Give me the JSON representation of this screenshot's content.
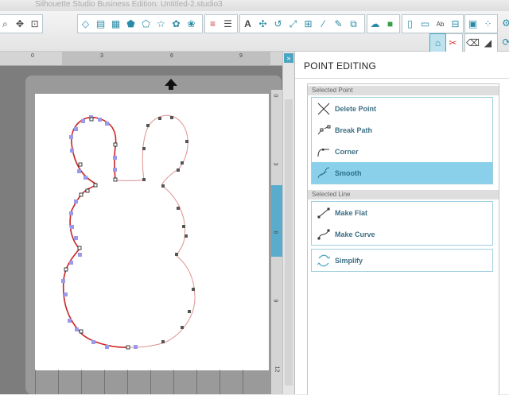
{
  "window": {
    "title": "Silhouette Studio Business Edition: Untitled-2.studio3"
  },
  "toolbar": {
    "text_tool_label": "A",
    "text_style_label": "Ab"
  },
  "ruler": {
    "top_numbers": [
      "0",
      "3",
      "6",
      "9"
    ],
    "right_numbers": [
      "0",
      "3",
      "6",
      "9",
      "12"
    ]
  },
  "panel": {
    "toggle_label": "»",
    "title": "POINT EDITING",
    "selected_point_header": "Selected Point",
    "selected_line_header": "Selected Line",
    "point_options": [
      {
        "label": "Delete Point",
        "icon": "delete-point-icon",
        "active": false
      },
      {
        "label": "Break Path",
        "icon": "break-path-icon",
        "active": false
      },
      {
        "label": "Corner",
        "icon": "corner-icon",
        "active": false
      },
      {
        "label": "Smooth",
        "icon": "smooth-icon",
        "active": true
      }
    ],
    "line_options": [
      {
        "label": "Make Flat",
        "icon": "make-flat-icon"
      },
      {
        "label": "Make Curve",
        "icon": "make-curve-icon"
      }
    ],
    "simplify": {
      "label": "Simplify",
      "icon": "simplify-icon"
    }
  },
  "colors": {
    "accent": "#4aa5c3",
    "active_option": "#8ad0ea",
    "path_selected": "#cc2222",
    "path_unselected": "#e09090",
    "handle": "#9a9ae8",
    "node": "#555555"
  }
}
